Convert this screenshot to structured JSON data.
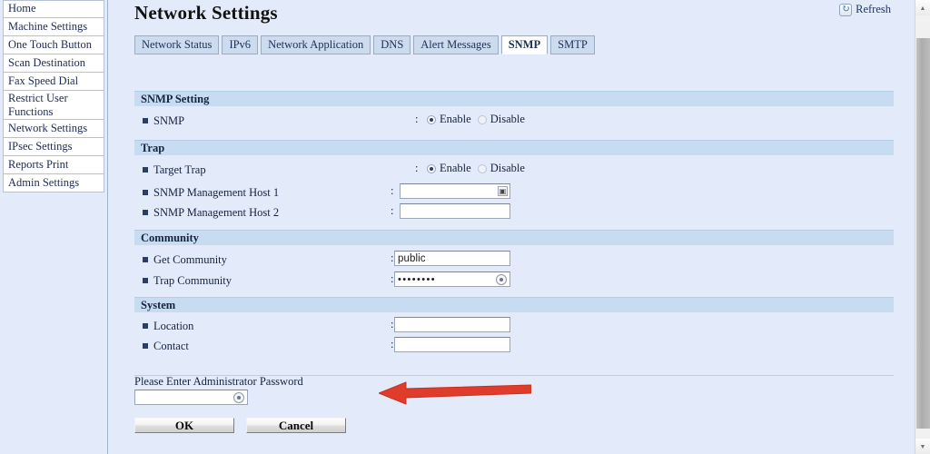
{
  "sidebar": {
    "items": [
      {
        "label": "Home",
        "two_line": false
      },
      {
        "label": "Machine Settings",
        "two_line": false
      },
      {
        "label": "One Touch Button",
        "two_line": false
      },
      {
        "label": "Scan Destination",
        "two_line": false
      },
      {
        "label": "Fax Speed Dial",
        "two_line": false
      },
      {
        "label": "Restrict User Functions",
        "two_line": true
      },
      {
        "label": "Network Settings",
        "two_line": false
      },
      {
        "label": "IPsec Settings",
        "two_line": false
      },
      {
        "label": "Reports Print",
        "two_line": false
      },
      {
        "label": "Admin Settings",
        "two_line": false
      }
    ]
  },
  "header": {
    "title": "Network Settings",
    "refresh_label": "Refresh",
    "refresh_icon": "refresh-icon"
  },
  "tabs": [
    {
      "label": "Network Status",
      "active": false
    },
    {
      "label": "IPv6",
      "active": false
    },
    {
      "label": "Network Application",
      "active": false
    },
    {
      "label": "DNS",
      "active": false
    },
    {
      "label": "Alert Messages",
      "active": false
    },
    {
      "label": "SNMP",
      "active": true
    },
    {
      "label": "SMTP",
      "active": false
    }
  ],
  "sections": {
    "snmp_setting": {
      "title": "SNMP Setting",
      "snmp_label": "SNMP",
      "colon": ":",
      "enable_label": "Enable",
      "disable_label": "Disable",
      "selected": "Enable"
    },
    "trap": {
      "title": "Trap",
      "target_trap_label": "Target Trap",
      "colon": ":",
      "enable_label": "Enable",
      "disable_label": "Disable",
      "selected": "Enable",
      "host1_label": "SNMP Management Host 1",
      "host1_value": "",
      "host1_placeholder": "",
      "host1_button_icon": "picker-button-icon",
      "host2_label": "SNMP Management Host 2",
      "host2_value": "",
      "host2_placeholder": ""
    },
    "community": {
      "title": "Community",
      "get_label": "Get Community",
      "get_value": "public",
      "trap_label": "Trap Community",
      "trap_value": "••••••••",
      "trap_reveal_icon": "reveal-password-icon",
      "colon": ":"
    },
    "system": {
      "title": "System",
      "location_label": "Location",
      "location_value": "",
      "contact_label": "Contact",
      "contact_value": "",
      "colon": ":"
    }
  },
  "password": {
    "prompt": "Please Enter Administrator Password",
    "value": "",
    "reveal_icon": "reveal-password-icon"
  },
  "buttons": {
    "ok": "OK",
    "cancel": "Cancel"
  },
  "scrollbar": {
    "up_icon": "chevron-up-icon",
    "down_icon": "chevron-down-icon"
  },
  "annotation": {
    "arrow_icon": "red-arrow-icon",
    "arrow_color": "#e03c2c"
  },
  "colors": {
    "page_background": "#e3eaf9",
    "section_header": "#c7dcf0",
    "tab_inactive": "#ccdcee",
    "tab_active": "#ffffff",
    "text": "#15233f",
    "accent_arrow": "#e03c2c"
  }
}
